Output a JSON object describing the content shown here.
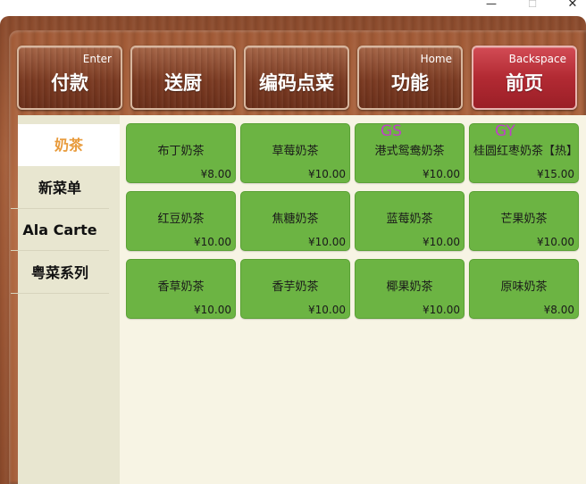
{
  "window": {
    "minimize": "—",
    "maximize": "☐",
    "close": "✕"
  },
  "actions": [
    {
      "label": "付款",
      "key": "Enter"
    },
    {
      "label": "送厨",
      "key": ""
    },
    {
      "label": "编码点菜",
      "key": ""
    },
    {
      "label": "功能",
      "key": "Home"
    },
    {
      "label": "前页",
      "key": "Backspace"
    }
  ],
  "categories": [
    {
      "label": "奶茶",
      "active": true
    },
    {
      "label": "新菜单",
      "active": false
    },
    {
      "label": "Ala Carte",
      "active": false
    },
    {
      "label": "粤菜系列",
      "active": false
    }
  ],
  "items": [
    {
      "name": "布丁奶茶",
      "price": "¥8.00"
    },
    {
      "name": "草莓奶茶",
      "price": "¥10.00"
    },
    {
      "name": "港式鸳鸯奶茶",
      "price": "¥10.00",
      "tag": "GS"
    },
    {
      "name": "桂圆红枣奶茶【热】",
      "price": "¥15.00",
      "tag": "GY"
    },
    {
      "name": "红豆奶茶",
      "price": "¥10.00"
    },
    {
      "name": "焦糖奶茶",
      "price": "¥10.00"
    },
    {
      "name": "蓝莓奶茶",
      "price": "¥10.00"
    },
    {
      "name": "芒果奶茶",
      "price": "¥10.00"
    },
    {
      "name": "香草奶茶",
      "price": "¥10.00"
    },
    {
      "name": "香芋奶茶",
      "price": "¥10.00"
    },
    {
      "name": "椰果奶茶",
      "price": "¥10.00"
    },
    {
      "name": "原味奶茶",
      "price": "¥8.00"
    }
  ],
  "colors": {
    "tile": "#6cb443",
    "active_category": "#e89a3a",
    "tag": "#c03fc8",
    "panel": "#f7f4e4"
  }
}
